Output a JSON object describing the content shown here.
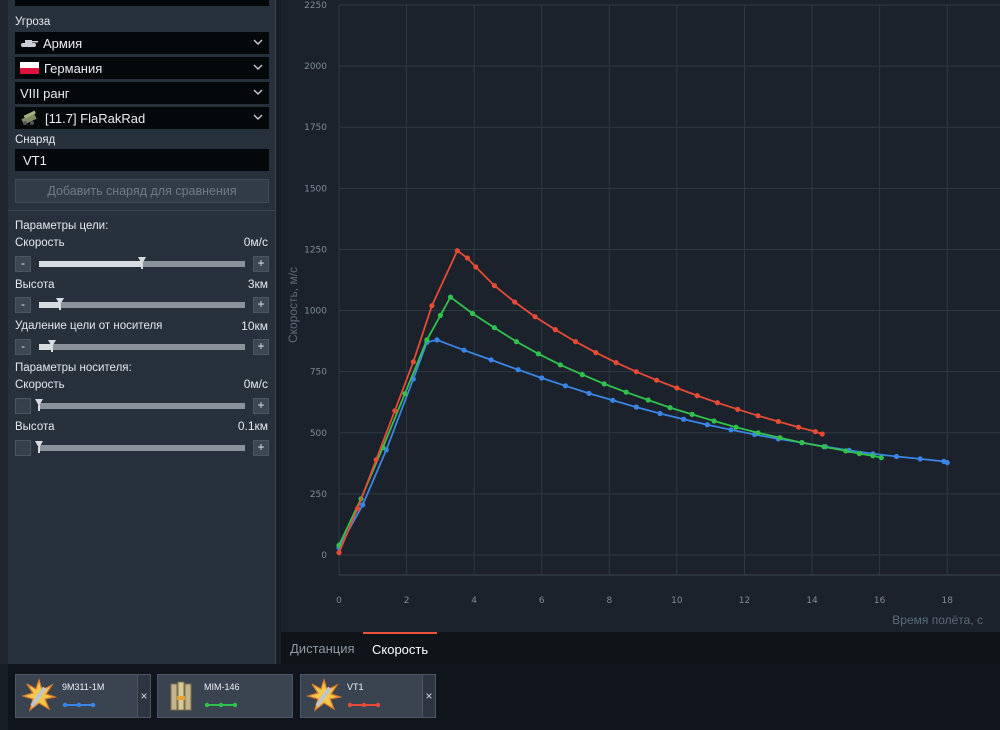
{
  "sidebar": {
    "threat_label": "Угроза",
    "threat_type": "Армия",
    "nation": "Германия",
    "rank": "VIII ранг",
    "vehicle": "[11.7] FlaRakRad",
    "shell_label": "Снаряд",
    "shell_value": "VT1",
    "add_shell_button": "Добавить снаряд для сравнения",
    "target_params_title": "Параметры цели:",
    "target_speed_label": "Скорость",
    "target_speed_value": "0м/с",
    "target_altitude_label": "Высота",
    "target_altitude_value": "3км",
    "target_distance_label": "Удаление цели от носителя",
    "target_distance_value": "10км",
    "carrier_params_title": "Параметры носителя:",
    "carrier_speed_label": "Скорость",
    "carrier_speed_value": "0м/с",
    "carrier_altitude_label": "Высота",
    "carrier_altitude_value": "0.1км",
    "minus": "-",
    "plus": "+",
    "sliders": {
      "target_speed": 0.5,
      "target_altitude": 0.1,
      "target_distance": 0.065,
      "carrier_speed": 0.0,
      "carrier_altitude": 0.0
    }
  },
  "tabs": [
    {
      "label": "Дистанция",
      "active": false
    },
    {
      "label": "Скорость",
      "active": true
    }
  ],
  "projectiles": [
    {
      "name": "9M311-1M",
      "color": "#3a86e6"
    },
    {
      "name": "MIM-146",
      "color": "#31c24d"
    },
    {
      "name": "VT1",
      "color": "#e64b36"
    }
  ],
  "close_glyph": "×",
  "chart_data": {
    "type": "line",
    "xlabel": "Время полёта, с",
    "ylabel": "Скорость, м/с",
    "xlim": [
      0,
      19
    ],
    "ylim": [
      0,
      2250
    ],
    "xticks": [
      0,
      2,
      4,
      6,
      8,
      10,
      12,
      14,
      16,
      18
    ],
    "yticks": [
      0,
      250,
      500,
      750,
      1000,
      1250,
      1500,
      1750,
      2000,
      2250
    ],
    "grid": true,
    "legend": "none",
    "series": [
      {
        "name": "9M311-1M",
        "color": "#3a86e6",
        "points": [
          [
            0,
            30
          ],
          [
            0.7,
            205
          ],
          [
            1.4,
            430
          ],
          [
            2.2,
            720
          ],
          [
            2.6,
            870
          ],
          [
            2.9,
            880
          ],
          [
            3.7,
            838
          ],
          [
            4.5,
            798
          ],
          [
            5.3,
            758
          ],
          [
            6.0,
            724
          ],
          [
            6.7,
            692
          ],
          [
            7.4,
            661
          ],
          [
            8.1,
            633
          ],
          [
            8.8,
            605
          ],
          [
            9.5,
            579
          ],
          [
            10.2,
            555
          ],
          [
            10.9,
            533
          ],
          [
            11.6,
            512
          ],
          [
            12.3,
            493
          ],
          [
            13.0,
            475
          ],
          [
            13.7,
            460
          ],
          [
            14.4,
            443
          ],
          [
            15.1,
            428
          ],
          [
            15.8,
            414
          ],
          [
            16.5,
            403
          ],
          [
            17.2,
            393
          ],
          [
            17.9,
            383
          ],
          [
            18.0,
            378
          ]
        ]
      },
      {
        "name": "MIM-146",
        "color": "#31c24d",
        "points": [
          [
            0,
            40
          ],
          [
            0.65,
            230
          ],
          [
            1.3,
            440
          ],
          [
            1.95,
            660
          ],
          [
            2.6,
            880
          ],
          [
            3.0,
            980
          ],
          [
            3.3,
            1055
          ],
          [
            3.95,
            988
          ],
          [
            4.6,
            930
          ],
          [
            5.25,
            873
          ],
          [
            5.9,
            823
          ],
          [
            6.55,
            778
          ],
          [
            7.2,
            738
          ],
          [
            7.85,
            700
          ],
          [
            8.5,
            666
          ],
          [
            9.15,
            634
          ],
          [
            9.8,
            603
          ],
          [
            10.45,
            575
          ],
          [
            11.1,
            548
          ],
          [
            11.75,
            523
          ],
          [
            12.4,
            500
          ],
          [
            13.05,
            480
          ],
          [
            13.7,
            460
          ],
          [
            14.35,
            443
          ],
          [
            15.0,
            426
          ],
          [
            15.4,
            415
          ],
          [
            15.8,
            406
          ],
          [
            16.05,
            398
          ]
        ]
      },
      {
        "name": "VT1",
        "color": "#e64b36",
        "points": [
          [
            0,
            10
          ],
          [
            0.55,
            190
          ],
          [
            1.1,
            390
          ],
          [
            1.65,
            590
          ],
          [
            2.2,
            790
          ],
          [
            2.75,
            1020
          ],
          [
            3.5,
            1245
          ],
          [
            3.8,
            1215
          ],
          [
            4.05,
            1178
          ],
          [
            4.6,
            1102
          ],
          [
            5.2,
            1035
          ],
          [
            5.8,
            975
          ],
          [
            6.4,
            922
          ],
          [
            7.0,
            873
          ],
          [
            7.6,
            828
          ],
          [
            8.2,
            787
          ],
          [
            8.8,
            750
          ],
          [
            9.4,
            715
          ],
          [
            10.0,
            683
          ],
          [
            10.6,
            652
          ],
          [
            11.2,
            623
          ],
          [
            11.8,
            596
          ],
          [
            12.4,
            570
          ],
          [
            13.0,
            546
          ],
          [
            13.6,
            523
          ],
          [
            14.1,
            505
          ],
          [
            14.3,
            495
          ]
        ]
      }
    ]
  }
}
